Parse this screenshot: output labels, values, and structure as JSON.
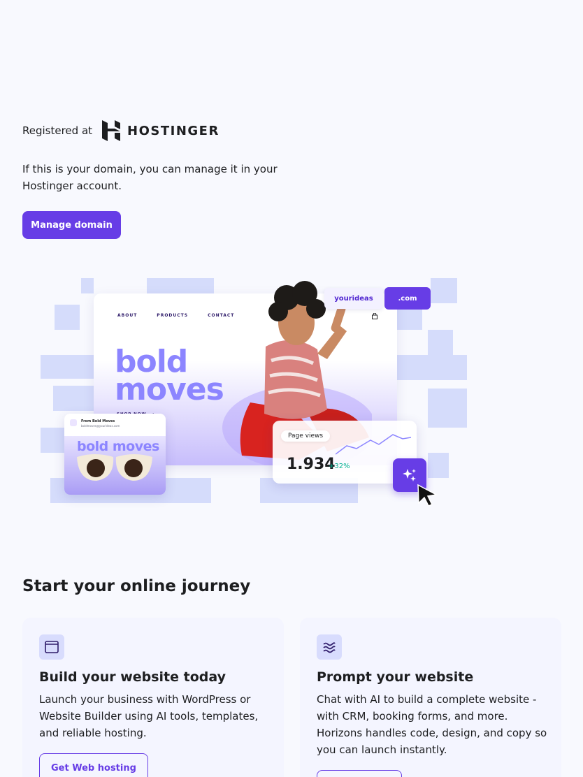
{
  "registrar": {
    "label": "Registered at",
    "brand": "HOSTINGER",
    "message": "If this is your domain, you can manage it in your Hostinger account.",
    "manage_button": "Manage domain"
  },
  "hero": {
    "nav": [
      "ABOUT",
      "PRODUCTS",
      "CONTACT"
    ],
    "headline_line1": "bold",
    "headline_line2": "moves",
    "shop_now": "SHOP NOW",
    "domain_name": "yourideas",
    "domain_tld": ".com",
    "mail_from": "From Bold Moves",
    "mail_sub": "boldmoves@yourideas.com",
    "mail_title": "bold moves",
    "views_label": "Page views",
    "views_value": "1.934",
    "views_delta": "+32%"
  },
  "journey": {
    "title": "Start your online journey",
    "cards": [
      {
        "icon": "browser-window-icon",
        "title": "Build your website today",
        "text": "Launch your business with WordPress or Website Builder using AI tools, templates, and reliable hosting.",
        "button": "Get Web hosting"
      },
      {
        "icon": "horizons-waves-icon",
        "title": "Prompt your website",
        "text": "Chat with AI to build a complete website - with CRM, booking forms, and more. Horizons handles code, design, and copy so you can launch instantly.",
        "button": ""
      }
    ]
  },
  "colors": {
    "background": "#f8f9fe",
    "accent": "#673de6",
    "card_bg": "#f4f5ff"
  }
}
